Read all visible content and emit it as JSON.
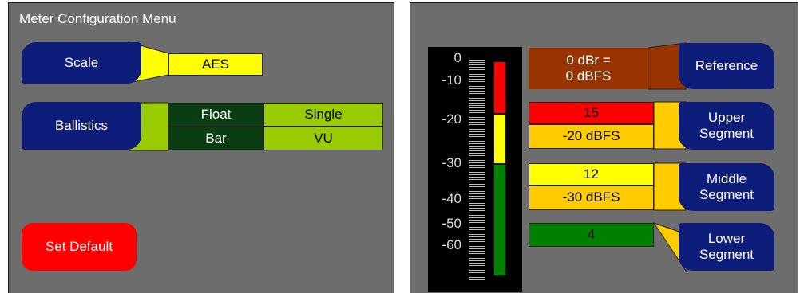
{
  "left": {
    "title": "Meter Configuration Menu",
    "scale": {
      "label": "Scale",
      "value": "AES"
    },
    "ballistics": {
      "label": "Ballistics",
      "options": {
        "float": "Float",
        "single": "Single",
        "bar": "Bar",
        "vu": "VU"
      }
    },
    "set_default_label": "Set Default"
  },
  "right": {
    "meter": {
      "ticks": [
        "0",
        "-10",
        "-20",
        "-30",
        "-40",
        "-50",
        "-60"
      ]
    },
    "reference": {
      "label": "Reference",
      "value_line1": "0 dBr =",
      "value_line2": "0 dBFS"
    },
    "upper_segment": {
      "label_line1": "Upper",
      "label_line2": "Segment",
      "value": "15",
      "threshold": "-20 dBFS"
    },
    "middle_segment": {
      "label_line1": "Middle",
      "label_line2": "Segment",
      "value": "12",
      "threshold": "-30 dBFS"
    },
    "lower_segment": {
      "label_line1": "Lower",
      "label_line2": "Segment",
      "value": "4"
    }
  },
  "colors": {
    "panel_bg": "#6d6d6d",
    "button_navy": "#0e1c7a",
    "scale_yellow": "#ffff00",
    "ballistics_dark_green": "#0b3d12",
    "ballistics_light_green": "#99cc00",
    "reference_brown": "#993300",
    "segment_red": "#ff0000",
    "segment_orange": "#ffcc00",
    "segment_yellow": "#ffff00",
    "segment_green": "#008000",
    "set_default_red": "#ff0000"
  }
}
